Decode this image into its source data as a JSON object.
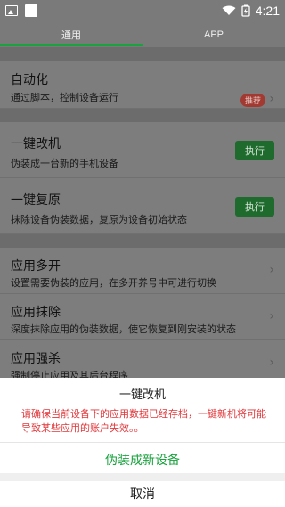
{
  "status_bar": {
    "time": "4:21",
    "icons": [
      "image-icon",
      "square-icon",
      "wifi-icon",
      "battery-icon"
    ]
  },
  "tabs": [
    {
      "label": "通用",
      "active": true
    },
    {
      "label": "APP",
      "active": false
    }
  ],
  "sections": {
    "automation": {
      "title": "自动化",
      "subtitle": "通过脚本，控制设备运行",
      "badge": "推荐"
    },
    "device": [
      {
        "title": "一键改机",
        "subtitle": "伪装成一台新的手机设备",
        "button": "执行"
      },
      {
        "title": "一键复原",
        "subtitle": "抹除设备伪装数据，复原为设备初始状态",
        "button": "执行"
      }
    ],
    "apps": [
      {
        "title": "应用多开",
        "subtitle": "设置需要伪装的应用，在多开养号中可进行切换"
      },
      {
        "title": "应用抹除",
        "subtitle": "深度抹除应用的伪装数据，使它恢复到刚安装的状态"
      },
      {
        "title": "应用强杀",
        "subtitle": "强制停止应用及其后台程序"
      }
    ]
  },
  "sheet": {
    "title": "一键改机",
    "warning": "请确保当前设备下的应用数据已经存档，一键新机将可能导致某些应用的账户失效。。",
    "confirm": "伪装成新设备",
    "cancel": "取消"
  },
  "colors": {
    "accent": "#19a23e",
    "warning": "#e0373a",
    "badge": "#d9534f",
    "dim_overlay": "#7d7d7d"
  }
}
